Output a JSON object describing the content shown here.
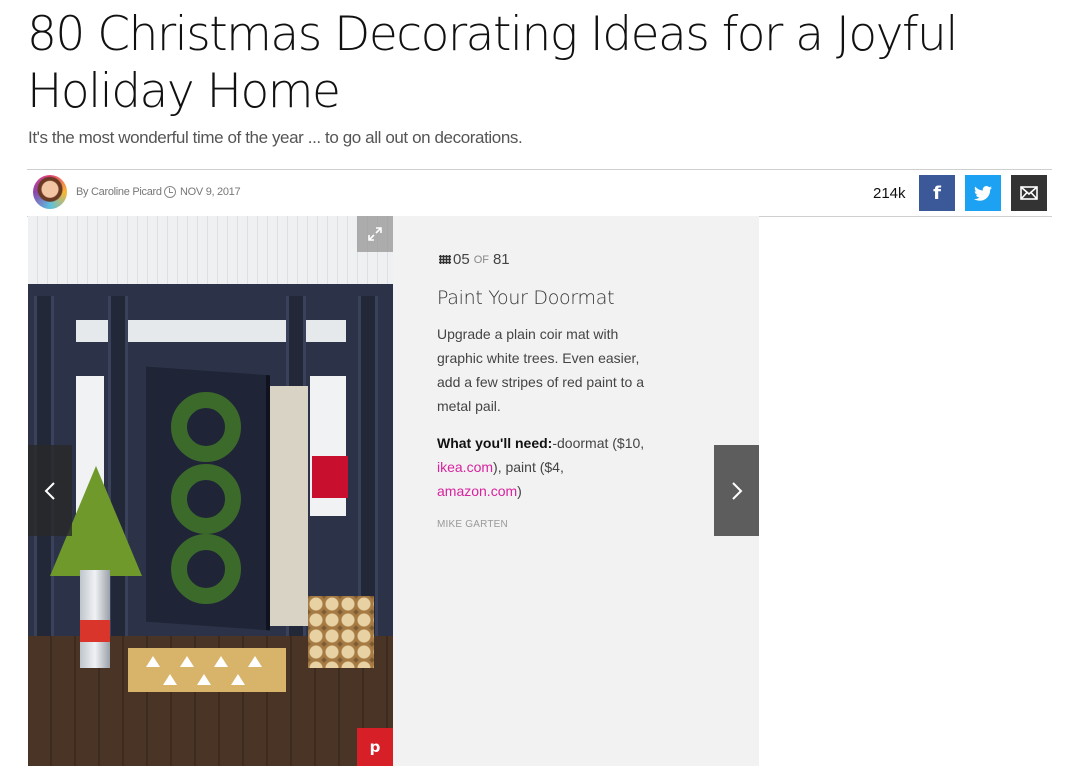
{
  "article": {
    "title": "80 Christmas Decorating Ideas for a Joyful Holiday Home",
    "subtitle": "It's the most wonderful time of the year ... to go all out on decorations."
  },
  "byline": {
    "author": "By Caroline Picard",
    "date": "NOV 9, 2017",
    "share_count": "214k",
    "avatar_icon": "author-avatar",
    "clock_icon": "clock-icon"
  },
  "social": {
    "facebook_glyph": "f",
    "facebook_color": "#3b5998",
    "twitter_color": "#1da1f2",
    "email_color": "#333333"
  },
  "slide": {
    "current": "05",
    "of": "OF",
    "total": "81",
    "title": "Paint Your Doormat",
    "description": "Upgrade a plain coir mat with graphic white trees. Even easier, add a few stripes of red paint to a metal pail.",
    "needs_label": "What you'll need:",
    "needs_text_1": "-doormat ($10, ",
    "link_1": "ikea.com",
    "needs_text_2": "), paint ($4, ",
    "link_2": "amazon.com",
    "needs_text_3": ")",
    "credit": "MIKE GARTEN",
    "link_color": "#d6239f",
    "pin_glyph": "p"
  }
}
